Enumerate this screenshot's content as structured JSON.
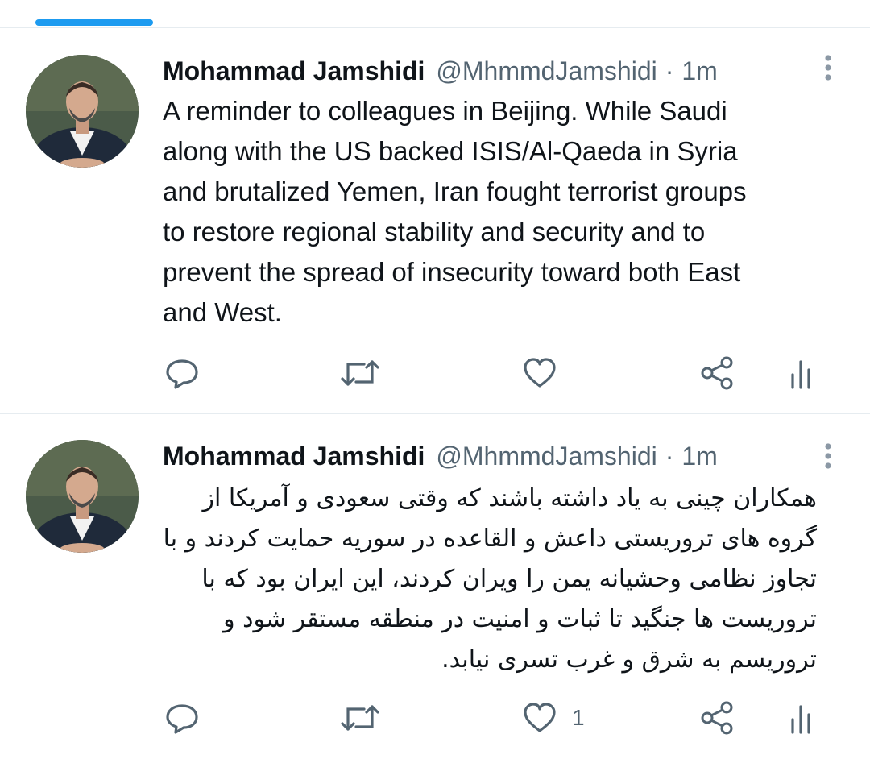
{
  "tweets": [
    {
      "author_name": "Mohammad Jamshidi",
      "handle": "@MhmmdJamshidi",
      "separator": "·",
      "time": "1m",
      "text_lines": [
        "A reminder to colleagues in Beijing. While Saudi",
        "along with the US backed ISIS/Al-Qaeda in Syria",
        "and brutalized Yemen, Iran fought terrorist groups",
        "to restore regional stability and security and to",
        "prevent the spread of insecurity toward both East",
        "and West."
      ],
      "like_count": "",
      "icons": {
        "reply": "reply-icon",
        "retweet": "retweet-icon",
        "like": "heart-icon",
        "share": "share-icon",
        "analytics": "analytics-icon",
        "more": "more-icon"
      }
    },
    {
      "author_name": "Mohammad Jamshidi",
      "handle": "@MhmmdJamshidi",
      "separator": "·",
      "time": "1m",
      "text_lines": [
        "همکاران چینی به یاد داشته باشند که وقتی سعودی و آمریکا از",
        "گروه های تروریستی داعش و القاعده در سوریه حمایت کردند و با",
        "تجاوز نظامی وحشیانه یمن را ویران کردند، این ایران بود که با",
        "تروریست ها جنگید تا ثبات و امنیت در منطقه مستقر شود و",
        "تروریسم به شرق و غرب تسری نیابد."
      ],
      "like_count": "1",
      "icons": {
        "reply": "reply-icon",
        "retweet": "retweet-icon",
        "like": "heart-icon",
        "share": "share-icon",
        "analytics": "analytics-icon",
        "more": "more-icon"
      }
    }
  ],
  "colors": {
    "accent": "#1d9bf0",
    "text": "#0f1419",
    "secondary": "#536471",
    "divider": "#e6ecf0"
  }
}
